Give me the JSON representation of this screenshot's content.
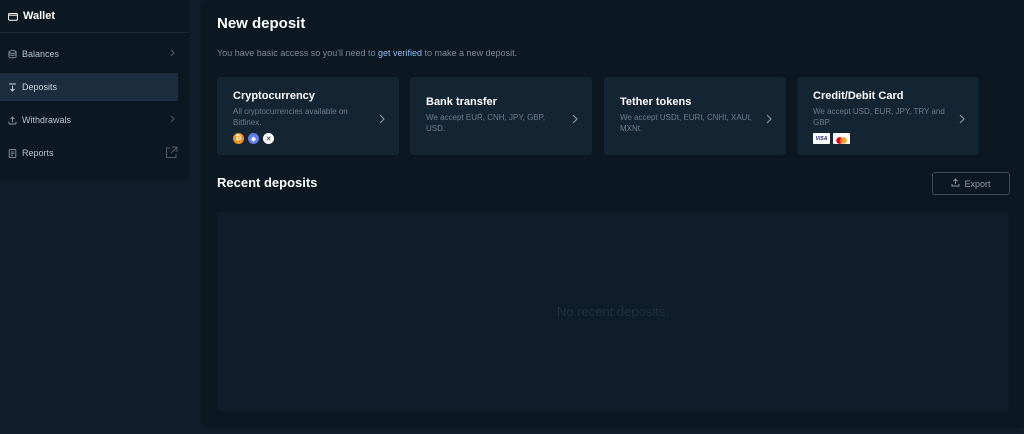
{
  "sidebar": {
    "header": "Wallet",
    "items": [
      {
        "label": "Balances"
      },
      {
        "label": "Deposits"
      },
      {
        "label": "Withdrawals"
      },
      {
        "label": "Reports"
      }
    ]
  },
  "main": {
    "title": "New deposit",
    "notice_before": "You have basic access so you'll need to ",
    "notice_link": "get verified",
    "notice_after": " to make a new deposit.",
    "cards": [
      {
        "title": "Cryptocurrency",
        "desc": "All cryptocurrencies available on Bitfinex."
      },
      {
        "title": "Bank transfer",
        "desc": "We accept EUR, CNH, JPY, GBP, USD."
      },
      {
        "title": "Tether tokens",
        "desc": "We accept USDt, EURt, CNHt, XAUt, MXNt."
      },
      {
        "title": "Credit/Debit Card",
        "desc": "We accept USD, EUR, JPY, TRY and GBP."
      }
    ],
    "recent_title": "Recent deposits",
    "export_label": "Export",
    "empty_text": "No recent deposits."
  },
  "icons": {
    "wallet": "wallet-icon",
    "balances": "database-icon",
    "deposits": "deposit-arrow-icon",
    "withdrawals": "upload-arrow-icon",
    "reports": "document-icon",
    "external": "external-link-icon",
    "export": "upload-icon",
    "chevron": "chevron-right-icon"
  },
  "colors": {
    "background": "#0f1d2a",
    "panel": "#0b1822",
    "card": "#132433",
    "link": "#8bb8f2",
    "active_item": "#1b2d3e"
  }
}
